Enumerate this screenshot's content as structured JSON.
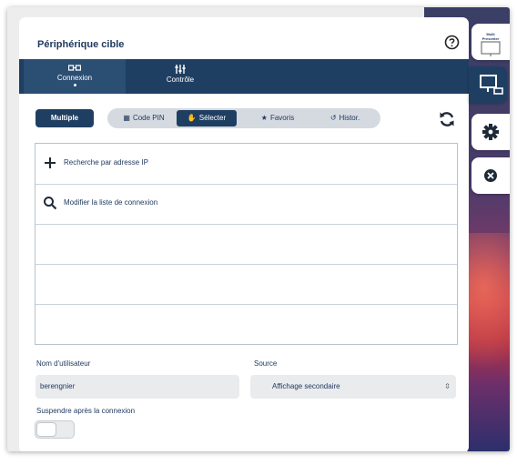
{
  "panel": {
    "title": "Périphérique cible",
    "help_icon": "question-circle-icon"
  },
  "tabs": [
    {
      "label": "Connexion",
      "icon": "connexion-icon",
      "active": true
    },
    {
      "label": "Contrôle",
      "icon": "sliders-icon",
      "active": false
    }
  ],
  "toolbar": {
    "multiple_label": "Multiple",
    "segments": [
      {
        "label": "Code PIN",
        "icon": "grid-icon",
        "active": false
      },
      {
        "label": "Sélecter",
        "icon": "hand-icon",
        "active": true
      },
      {
        "label": "Favoris",
        "icon": "star-icon",
        "active": false
      },
      {
        "label": "Histor.",
        "icon": "history-icon",
        "active": false
      }
    ],
    "refresh_icon": "refresh-icon"
  },
  "connection_list": [
    {
      "label": "Recherche par adresse IP",
      "icon": "plus-icon"
    },
    {
      "label": "Modifier la liste de connexion",
      "icon": "search-icon"
    },
    {
      "label": ""
    },
    {
      "label": ""
    },
    {
      "label": ""
    }
  ],
  "form": {
    "username_label": "Nom d'utilisateur",
    "username_value": "berengnier",
    "source_label": "Source",
    "source_value": "Affichage secondaire",
    "suspend_label": "Suspendre après la connexion",
    "suspend_on": false
  },
  "sidebar": {
    "multi_presenter_line1": "Multi",
    "multi_presenter_line2": "Presenter",
    "buttons": [
      "multi-presenter-icon",
      "display-connect-icon",
      "gear-icon",
      "close-icon"
    ]
  },
  "colors": {
    "navy": "#1f3f62",
    "text": "#1f3a60",
    "segment_bg": "#d5dae0",
    "field_bg": "#e9ebed"
  }
}
